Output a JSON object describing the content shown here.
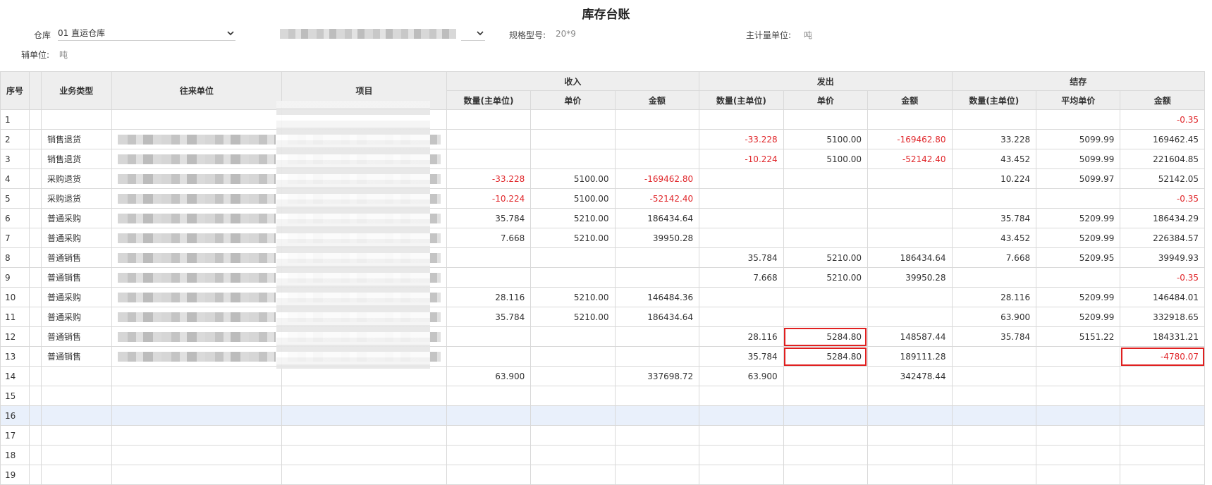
{
  "page": {
    "title": "库存台账"
  },
  "filters": {
    "warehouse_label": "仓库",
    "warehouse_value": "01 直运仓库",
    "spec_label": "规格型号:",
    "spec_value": "20*9",
    "main_unit_label": "主计量单位:",
    "main_unit_value": "吨",
    "aux_unit_label": "辅单位:",
    "aux_unit_value": "吨"
  },
  "table": {
    "headers": {
      "seq": "序号",
      "biz_type": "业务类型",
      "partner": "往来单位",
      "item": "项目",
      "income": "收入",
      "outgo": "发出",
      "balance": "结存",
      "qty": "数量(主单位)",
      "price": "单价",
      "avg_price": "平均单价",
      "amount": "金额"
    },
    "rows": [
      {
        "seq": "1",
        "type": "",
        "in_qty": "",
        "in_price": "",
        "in_amt": "",
        "out_qty": "",
        "out_price": "",
        "out_amt": "",
        "bal_qty": "",
        "bal_price": "",
        "bal_amt": "-0.35"
      },
      {
        "seq": "2",
        "type": "销售退货",
        "in_qty": "",
        "in_price": "",
        "in_amt": "",
        "out_qty": "-33.228",
        "out_price": "5100.00",
        "out_amt": "-169462.80",
        "bal_qty": "33.228",
        "bal_price": "5099.99",
        "bal_amt": "169462.45"
      },
      {
        "seq": "3",
        "type": "销售退货",
        "in_qty": "",
        "in_price": "",
        "in_amt": "",
        "out_qty": "-10.224",
        "out_price": "5100.00",
        "out_amt": "-52142.40",
        "bal_qty": "43.452",
        "bal_price": "5099.99",
        "bal_amt": "221604.85"
      },
      {
        "seq": "4",
        "type": "采购退货",
        "in_qty": "-33.228",
        "in_price": "5100.00",
        "in_amt": "-169462.80",
        "out_qty": "",
        "out_price": "",
        "out_amt": "",
        "bal_qty": "10.224",
        "bal_price": "5099.97",
        "bal_amt": "52142.05"
      },
      {
        "seq": "5",
        "type": "采购退货",
        "in_qty": "-10.224",
        "in_price": "5100.00",
        "in_amt": "-52142.40",
        "out_qty": "",
        "out_price": "",
        "out_amt": "",
        "bal_qty": "",
        "bal_price": "",
        "bal_amt": "-0.35"
      },
      {
        "seq": "6",
        "type": "普通采购",
        "in_qty": "35.784",
        "in_price": "5210.00",
        "in_amt": "186434.64",
        "out_qty": "",
        "out_price": "",
        "out_amt": "",
        "bal_qty": "35.784",
        "bal_price": "5209.99",
        "bal_amt": "186434.29"
      },
      {
        "seq": "7",
        "type": "普通采购",
        "in_qty": "7.668",
        "in_price": "5210.00",
        "in_amt": "39950.28",
        "out_qty": "",
        "out_price": "",
        "out_amt": "",
        "bal_qty": "43.452",
        "bal_price": "5209.99",
        "bal_amt": "226384.57"
      },
      {
        "seq": "8",
        "type": "普通销售",
        "in_qty": "",
        "in_price": "",
        "in_amt": "",
        "out_qty": "35.784",
        "out_price": "5210.00",
        "out_amt": "186434.64",
        "bal_qty": "7.668",
        "bal_price": "5209.95",
        "bal_amt": "39949.93"
      },
      {
        "seq": "9",
        "type": "普通销售",
        "in_qty": "",
        "in_price": "",
        "in_amt": "",
        "out_qty": "7.668",
        "out_price": "5210.00",
        "out_amt": "39950.28",
        "bal_qty": "",
        "bal_price": "",
        "bal_amt": "-0.35"
      },
      {
        "seq": "10",
        "type": "普通采购",
        "in_qty": "28.116",
        "in_price": "5210.00",
        "in_amt": "146484.36",
        "out_qty": "",
        "out_price": "",
        "out_amt": "",
        "bal_qty": "28.116",
        "bal_price": "5209.99",
        "bal_amt": "146484.01"
      },
      {
        "seq": "11",
        "type": "普通采购",
        "in_qty": "35.784",
        "in_price": "5210.00",
        "in_amt": "186434.64",
        "out_qty": "",
        "out_price": "",
        "out_amt": "",
        "bal_qty": "63.900",
        "bal_price": "5209.99",
        "bal_amt": "332918.65"
      },
      {
        "seq": "12",
        "type": "普通销售",
        "in_qty": "",
        "in_price": "",
        "in_amt": "",
        "out_qty": "28.116",
        "out_price": "5284.80",
        "out_amt": "148587.44",
        "bal_qty": "35.784",
        "bal_price": "5151.22",
        "bal_amt": "184331.21",
        "hl_out_price": true
      },
      {
        "seq": "13",
        "type": "普通销售",
        "in_qty": "",
        "in_price": "",
        "in_amt": "",
        "out_qty": "35.784",
        "out_price": "5284.80",
        "out_amt": "189111.28",
        "bal_qty": "",
        "bal_price": "",
        "bal_amt": "-4780.07",
        "hl_out_price": true,
        "hl_bal_amt": true
      },
      {
        "seq": "14",
        "type": "",
        "in_qty": "63.900",
        "in_price": "",
        "in_amt": "337698.72",
        "out_qty": "63.900",
        "out_price": "",
        "out_amt": "342478.44",
        "bal_qty": "",
        "bal_price": "",
        "bal_amt": ""
      },
      {
        "seq": "15",
        "type": "",
        "in_qty": "",
        "in_price": "",
        "in_amt": "",
        "out_qty": "",
        "out_price": "",
        "out_amt": "",
        "bal_qty": "",
        "bal_price": "",
        "bal_amt": ""
      },
      {
        "seq": "16",
        "type": "",
        "in_qty": "",
        "in_price": "",
        "in_amt": "",
        "out_qty": "",
        "out_price": "",
        "out_amt": "",
        "bal_qty": "",
        "bal_price": "",
        "bal_amt": "",
        "selected": true
      },
      {
        "seq": "17",
        "type": "",
        "in_qty": "",
        "in_price": "",
        "in_amt": "",
        "out_qty": "",
        "out_price": "",
        "out_amt": "",
        "bal_qty": "",
        "bal_price": "",
        "bal_amt": ""
      },
      {
        "seq": "18",
        "type": "",
        "in_qty": "",
        "in_price": "",
        "in_amt": "",
        "out_qty": "",
        "out_price": "",
        "out_amt": "",
        "bal_qty": "",
        "bal_price": "",
        "bal_amt": ""
      },
      {
        "seq": "19",
        "type": "",
        "in_qty": "",
        "in_price": "",
        "in_amt": "",
        "out_qty": "",
        "out_price": "",
        "out_amt": "",
        "bal_qty": "",
        "bal_price": "",
        "bal_amt": ""
      }
    ]
  },
  "colors": {
    "negative": "#e0262a",
    "highlight": "#e02020",
    "header_bg": "#eeeeee",
    "selected_row": "#e9f0fb"
  }
}
